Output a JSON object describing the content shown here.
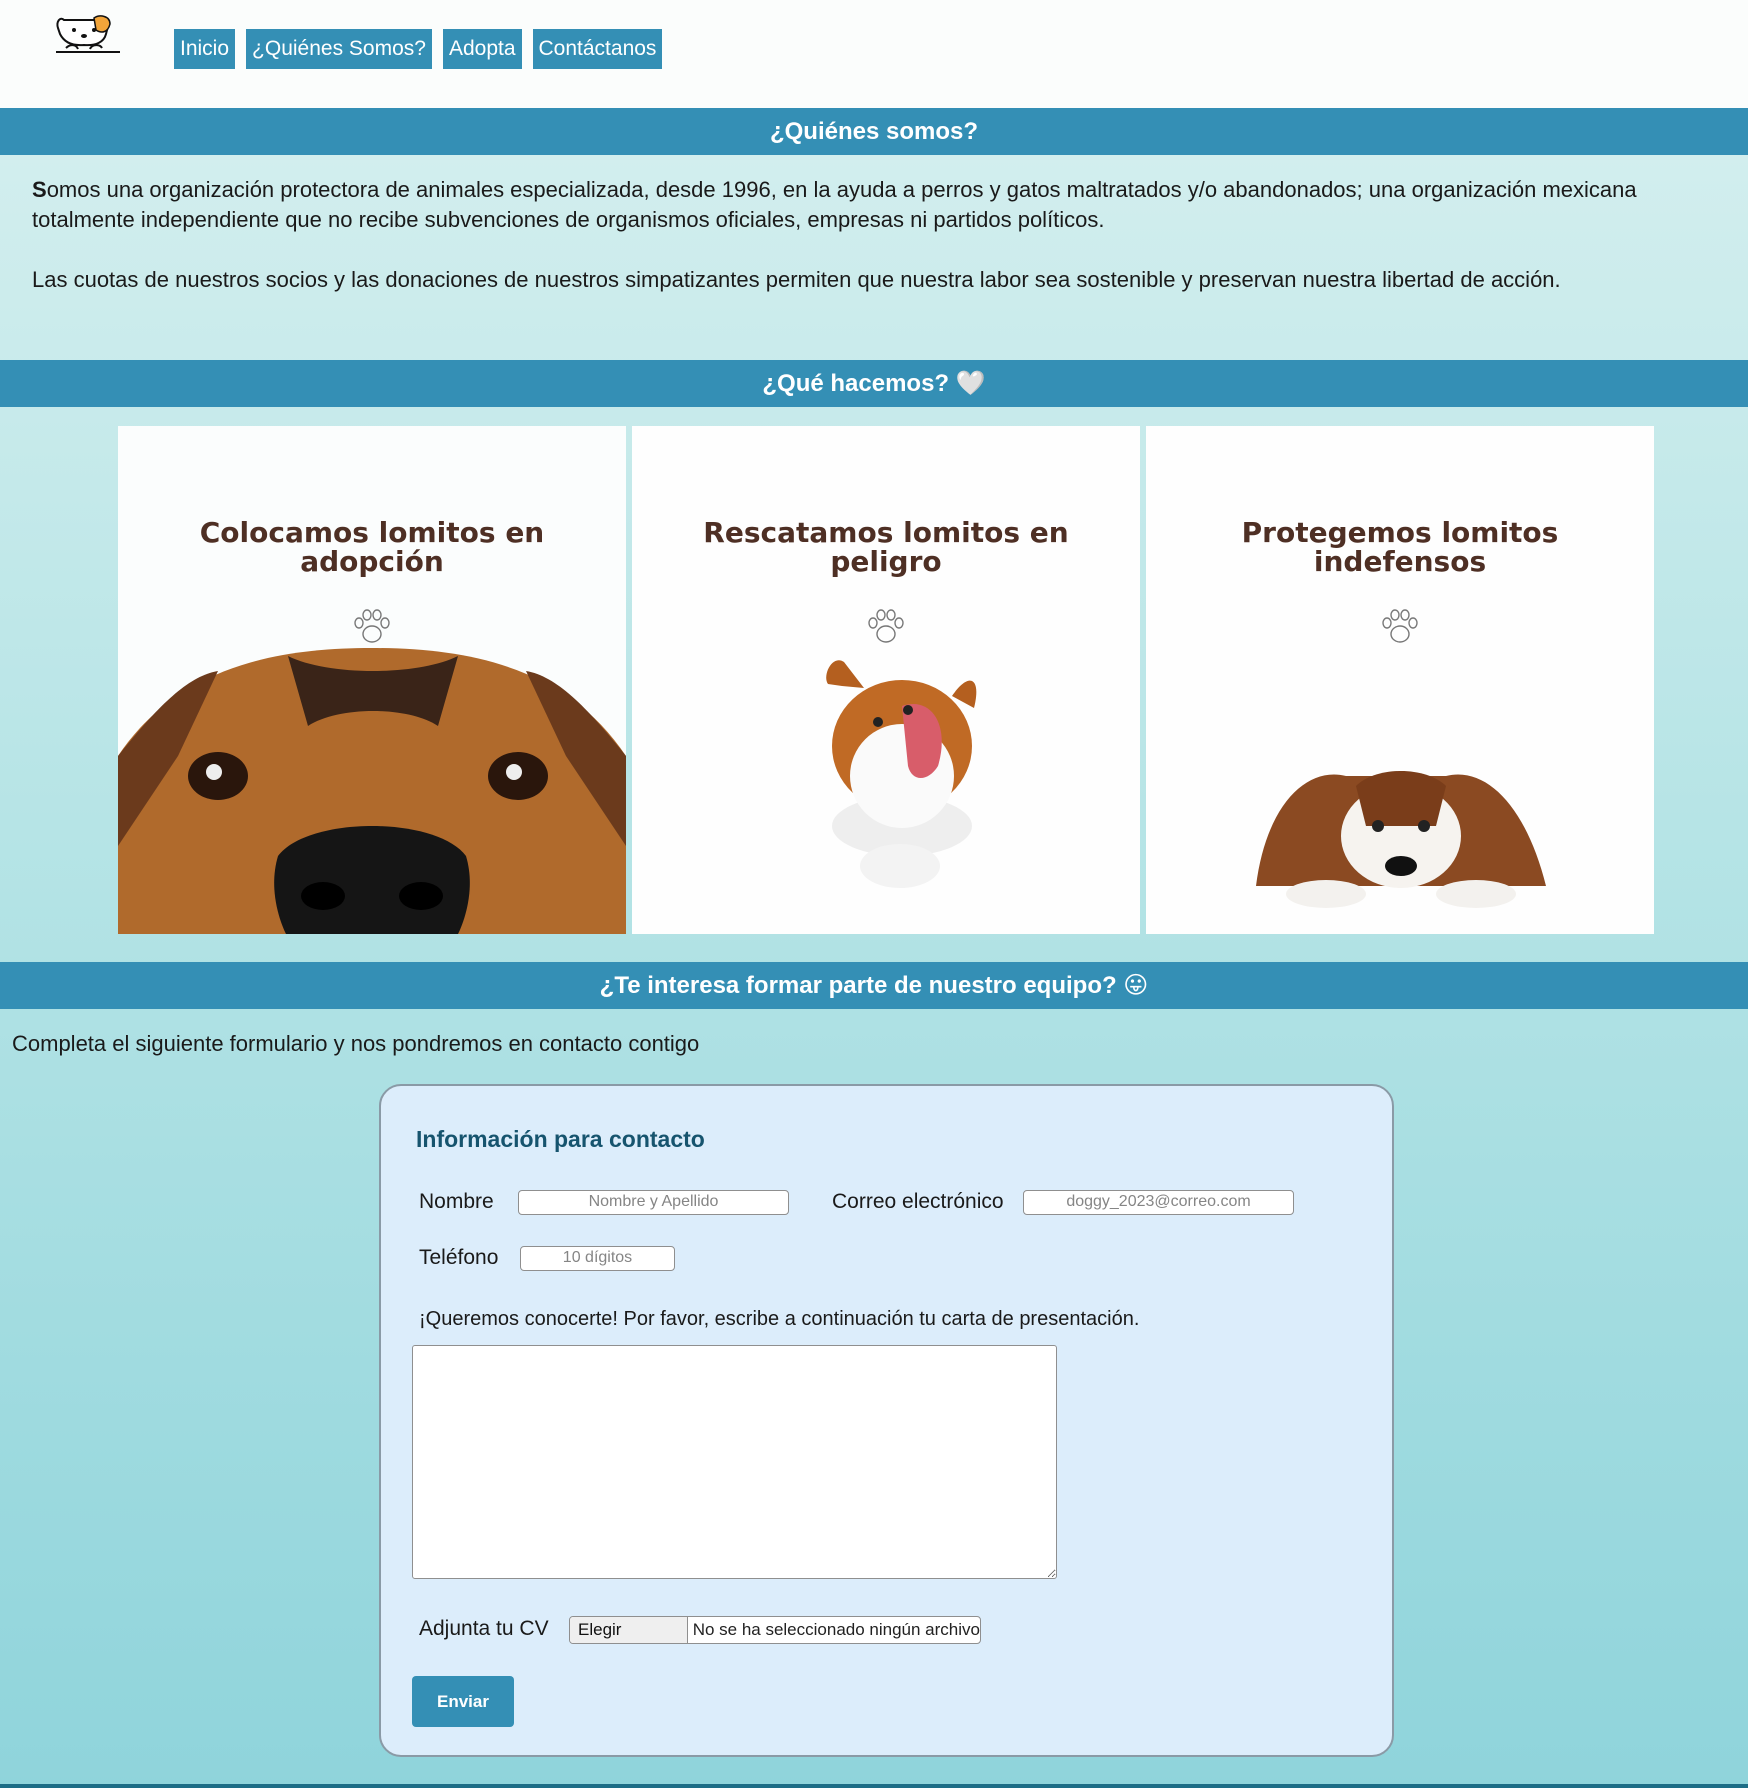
{
  "nav": {
    "items": [
      {
        "label": "Inicio"
      },
      {
        "label": "¿Quiénes Somos?"
      },
      {
        "label": "Adopta"
      },
      {
        "label": "Contáctanos"
      }
    ]
  },
  "about": {
    "title": "¿Quiénes somos?",
    "first_letter": "S",
    "paragraph1_rest": "omos una organización protectora de animales especializada, desde 1996, en la ayuda a perros y gatos maltratados y/o abandonados; una organización mexicana totalmente independiente que no recibe subvenciones de organismos oficiales, empresas ni partidos políticos.",
    "paragraph2": "Las cuotas de nuestros socios y las donaciones de nuestros simpatizantes permiten que nuestra labor sea sostenible y preservan nuestra libertad de acción."
  },
  "what": {
    "title": "¿Qué hacemos? 🤍",
    "cards": [
      {
        "title": "Colocamos lomitos en adopción"
      },
      {
        "title": "Rescatamos lomitos en peligro"
      },
      {
        "title": "Protegemos lomitos indefensos"
      }
    ]
  },
  "team": {
    "title": "¿Te interesa formar parte de nuestro equipo? 😛",
    "intro": "Completa el siguiente formulario y nos pondremos en contacto contigo"
  },
  "form": {
    "heading": "Información para contacto",
    "name_label": "Nombre",
    "name_placeholder": "Nombre y Apellido",
    "email_label": "Correo electrónico",
    "email_placeholder": "doggy_2023@correo.com",
    "phone_label": "Teléfono",
    "phone_placeholder": "10 dígitos",
    "letter_label": "¡Queremos conocerte! Por favor, escribe a continuación tu carta de presentación.",
    "cv_label": "Adjunta tu CV",
    "file_button": "Elegir archivo",
    "file_status": "No se ha seleccionado ningún archivo",
    "submit": "Enviar"
  },
  "colors": {
    "accent": "#348fb5",
    "card_title": "#4e2f24",
    "form_bg": "#dcedfb"
  },
  "icons": [
    "dog-logo-icon",
    "paw-icon",
    "heart-icon"
  ]
}
